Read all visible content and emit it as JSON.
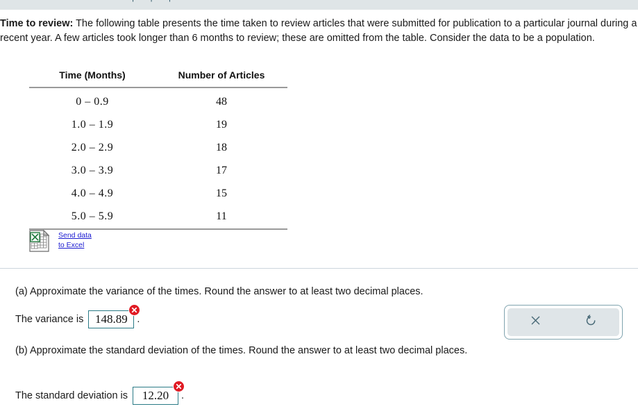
{
  "top_band": {
    "ghost_text": "| | |"
  },
  "statement": {
    "bold_lead": "Time to review:",
    "body": " The following table presents the time taken to review articles that were submitted for publication to a particular journal during a recent year. A few articles took longer than 6 months to review; these are omitted from the table. Consider the data to be a population."
  },
  "table": {
    "headers": [
      "Time (Months)",
      "Number of Articles"
    ],
    "rows": [
      {
        "time": "0 – 0.9",
        "count": "48"
      },
      {
        "time": "1.0 – 1.9",
        "count": "19"
      },
      {
        "time": "2.0 – 2.9",
        "count": "18"
      },
      {
        "time": "3.0 – 3.9",
        "count": "17"
      },
      {
        "time": "4.0 – 4.9",
        "count": "15"
      },
      {
        "time": "5.0 – 5.9",
        "count": "11"
      }
    ]
  },
  "excel": {
    "icon_name": "excel-file-icon",
    "link_line1": "Send data",
    "link_line2": "to Excel"
  },
  "parts": {
    "a": {
      "question": "(a) Approximate the variance of the times. Round the answer to at least two decimal places.",
      "answer_label": "The variance is",
      "answer_value": "148.89",
      "answer_placeholder": "",
      "trailing": ".",
      "status": "incorrect",
      "status_glyph": "✕"
    },
    "b": {
      "question": "(b) Approximate the standard deviation of the times. Round the answer to at least two decimal places.",
      "answer_label": "The standard deviation is",
      "answer_value": "12.20",
      "answer_placeholder": "",
      "trailing": ".",
      "status": "incorrect",
      "status_glyph": "✕"
    }
  },
  "tool_panel": {
    "clear_label": "✕",
    "undo_label": "↺"
  },
  "colors": {
    "band": "#dfe5e7",
    "input_border": "#2a7a86",
    "error_badge": "#e01b24",
    "link": "#1a1ad0",
    "panel_border": "#7fa3ae",
    "panel_fill": "#dfe5e8",
    "icon_stroke": "#4a6b78",
    "rule": "#9a9a9a"
  }
}
